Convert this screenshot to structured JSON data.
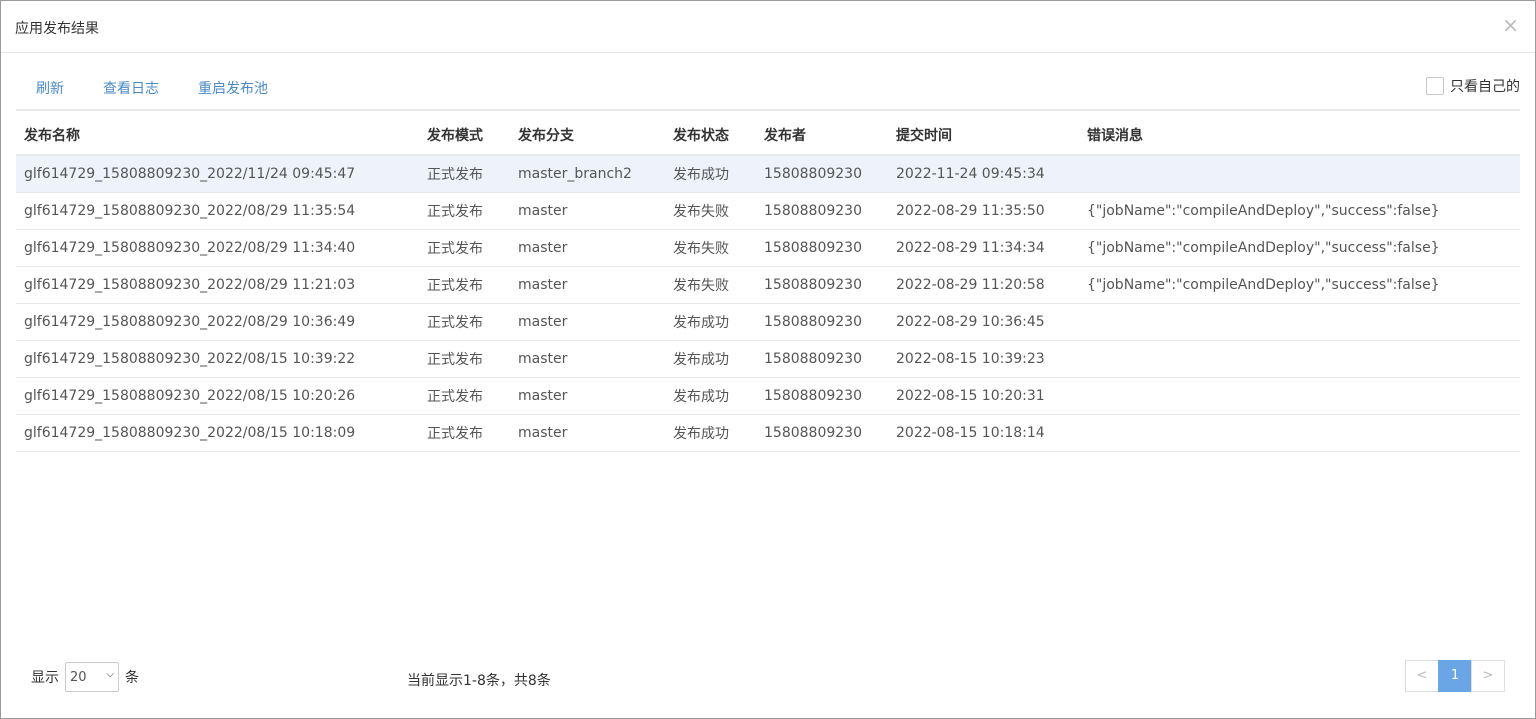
{
  "modal": {
    "title": "应用发布结果",
    "close_label": "×"
  },
  "toolbar": {
    "refresh": "刷新",
    "view_log": "查看日志",
    "restart_pool": "重启发布池",
    "own_only": "只看自己的"
  },
  "table": {
    "headers": [
      "发布名称",
      "发布模式",
      "发布分支",
      "发布状态",
      "发布者",
      "提交时间",
      "错误消息"
    ],
    "rows": [
      [
        "glf614729_15808809230_2022/11/24 09:45:47",
        "正式发布",
        "master_branch2",
        "发布成功",
        "15808809230",
        "2022-11-24 09:45:34",
        ""
      ],
      [
        "glf614729_15808809230_2022/08/29 11:35:54",
        "正式发布",
        "master",
        "发布失败",
        "15808809230",
        "2022-08-29 11:35:50",
        "{\"jobName\":\"compileAndDeploy\",\"success\":false}"
      ],
      [
        "glf614729_15808809230_2022/08/29 11:34:40",
        "正式发布",
        "master",
        "发布失败",
        "15808809230",
        "2022-08-29 11:34:34",
        "{\"jobName\":\"compileAndDeploy\",\"success\":false}"
      ],
      [
        "glf614729_15808809230_2022/08/29 11:21:03",
        "正式发布",
        "master",
        "发布失败",
        "15808809230",
        "2022-08-29 11:20:58",
        "{\"jobName\":\"compileAndDeploy\",\"success\":false}"
      ],
      [
        "glf614729_15808809230_2022/08/29 10:36:49",
        "正式发布",
        "master",
        "发布成功",
        "15808809230",
        "2022-08-29 10:36:45",
        ""
      ],
      [
        "glf614729_15808809230_2022/08/15 10:39:22",
        "正式发布",
        "master",
        "发布成功",
        "15808809230",
        "2022-08-15 10:39:23",
        ""
      ],
      [
        "glf614729_15808809230_2022/08/15 10:20:26",
        "正式发布",
        "master",
        "发布成功",
        "15808809230",
        "2022-08-15 10:20:31",
        ""
      ],
      [
        "glf614729_15808809230_2022/08/15 10:18:09",
        "正式发布",
        "master",
        "发布成功",
        "15808809230",
        "2022-08-15 10:18:14",
        ""
      ]
    ]
  },
  "footer": {
    "show_label": "显示",
    "page_size": "20",
    "unit_label": "条",
    "summary": "当前显示1-8条，共8条",
    "prev": "<",
    "current_page": "1",
    "next": ">"
  },
  "colors": {
    "link": "#4a8bc6",
    "active_page": "#6aa6e6",
    "selected_row": "#eef3fb"
  }
}
